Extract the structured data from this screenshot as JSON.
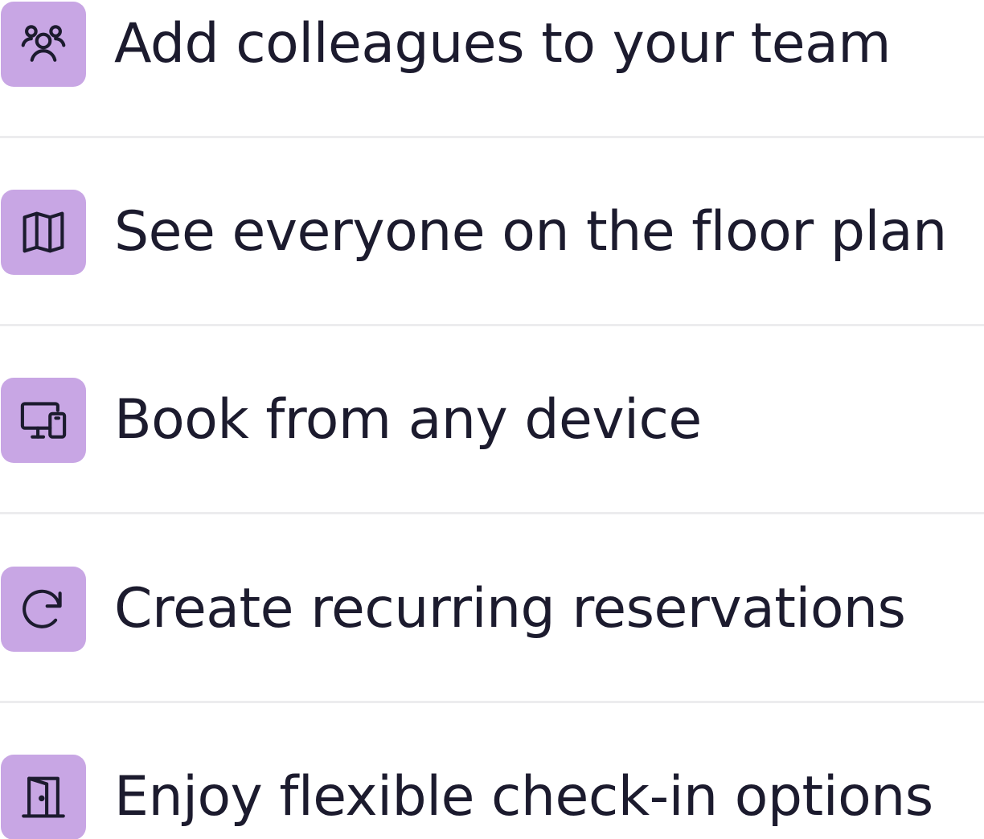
{
  "features": [
    {
      "label": "Add colleagues to your team",
      "icon": "team-icon"
    },
    {
      "label": "See everyone on the floor plan",
      "icon": "map-icon"
    },
    {
      "label": "Book from any device",
      "icon": "devices-icon"
    },
    {
      "label": "Create recurring reservations",
      "icon": "refresh-icon"
    },
    {
      "label": "Enjoy flexible check-in options",
      "icon": "door-icon"
    }
  ],
  "colors": {
    "icon_tile": "#c8a6e4",
    "text": "#1c1b2e",
    "divider": "#ececee"
  }
}
